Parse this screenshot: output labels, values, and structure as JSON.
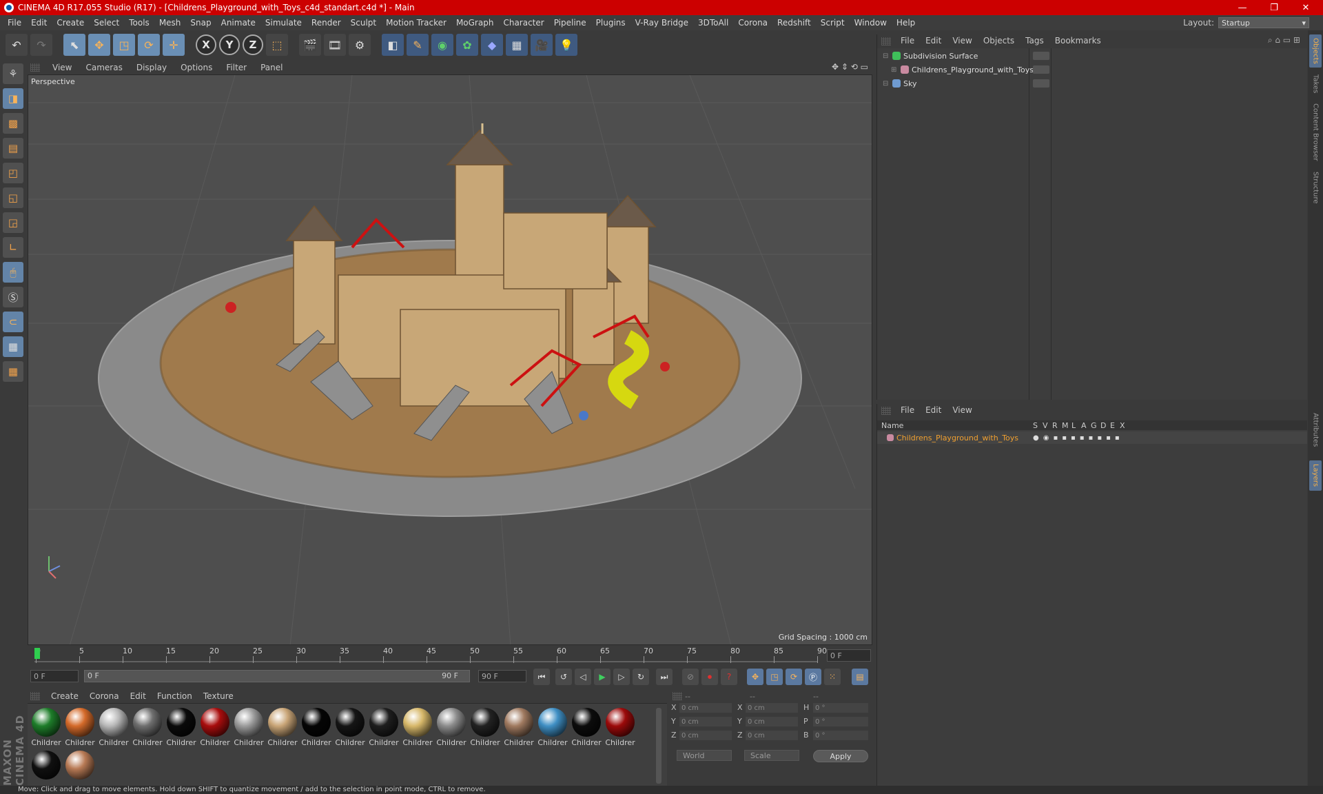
{
  "window": {
    "title": "CINEMA 4D R17.055 Studio (R17) - [Childrens_Playground_with_Toys_c4d_standart.c4d *] - Main",
    "minimize": "—",
    "restore": "❐",
    "close": "✕"
  },
  "menu": {
    "items": [
      "File",
      "Edit",
      "Create",
      "Select",
      "Tools",
      "Mesh",
      "Snap",
      "Animate",
      "Simulate",
      "Render",
      "Sculpt",
      "Motion Tracker",
      "MoGraph",
      "Character",
      "Pipeline",
      "Plugins",
      "V-Ray Bridge",
      "3DToAll",
      "Corona",
      "Redshift",
      "Script",
      "Window",
      "Help"
    ],
    "layout_label": "Layout:",
    "layout_value": "Startup"
  },
  "toolbar": {
    "axis_x": "X",
    "axis_y": "Y",
    "axis_z": "Z"
  },
  "viewport": {
    "menu": [
      "View",
      "Cameras",
      "Display",
      "Options",
      "Filter",
      "Panel"
    ],
    "camera_label": "Perspective",
    "grid_spacing": "Grid Spacing : 1000 cm"
  },
  "timeline": {
    "ticks": [
      "0",
      "5",
      "10",
      "15",
      "20",
      "25",
      "30",
      "35",
      "40",
      "45",
      "50",
      "55",
      "60",
      "65",
      "70",
      "75",
      "80",
      "85",
      "90"
    ],
    "current_frame": "0 F",
    "start_field": "0 F",
    "range_left": "0 F",
    "range_right": "90 F",
    "end_field": "90 F"
  },
  "materials": {
    "menu": [
      "Create",
      "Corona",
      "Edit",
      "Function",
      "Texture"
    ],
    "items": [
      {
        "label": "Childrer",
        "color": "#1e7d2a"
      },
      {
        "label": "Childrer",
        "color": "#d46a2a"
      },
      {
        "label": "Childrer",
        "color": "#b8b8b8"
      },
      {
        "label": "Childrer",
        "color": "#6f6f6f"
      },
      {
        "label": "Childrer",
        "color": "#0a0a0a"
      },
      {
        "label": "Childrer",
        "color": "#a80d0d"
      },
      {
        "label": "Childrer",
        "color": "#9b9b9b"
      },
      {
        "label": "Childrer",
        "color": "#c9a577"
      },
      {
        "label": "Childrer",
        "color": "#050505"
      },
      {
        "label": "Childrer",
        "color": "#151515"
      },
      {
        "label": "Childrer",
        "color": "#1e1e1e"
      },
      {
        "label": "Childrer",
        "color": "#d7b86a"
      },
      {
        "label": "Childrer",
        "color": "#8c8c8c"
      },
      {
        "label": "Childrer",
        "color": "#222222"
      },
      {
        "label": "Childrer",
        "color": "#a07a60"
      },
      {
        "label": "Childrer",
        "color": "#3f8fc4"
      },
      {
        "label": "Childrer",
        "color": "#0c0c0c"
      },
      {
        "label": "Childrer",
        "color": "#9c0a0a"
      },
      {
        "label": "",
        "color": "#101010"
      },
      {
        "label": "",
        "color": "#b87a55"
      }
    ]
  },
  "coords": {
    "header": [
      "--",
      "--",
      "--"
    ],
    "rows": [
      {
        "a": "X",
        "av": "0 cm",
        "b": "X",
        "bv": "0 cm",
        "c": "H",
        "cv": "0 °"
      },
      {
        "a": "Y",
        "av": "0 cm",
        "b": "Y",
        "bv": "0 cm",
        "c": "P",
        "cv": "0 °"
      },
      {
        "a": "Z",
        "av": "0 cm",
        "b": "Z",
        "bv": "0 cm",
        "c": "B",
        "cv": "0 °"
      }
    ],
    "mode": "World",
    "scale": "Scale",
    "apply": "Apply"
  },
  "object_manager": {
    "menu": [
      "File",
      "Edit",
      "View",
      "Objects",
      "Tags",
      "Bookmarks"
    ],
    "objects": [
      {
        "name": "Subdivision Surface",
        "color": "#3fbf5a",
        "level": 0
      },
      {
        "name": "Childrens_Playground_with_Toys",
        "color": "#c98aa0",
        "level": 1
      },
      {
        "name": "Sky",
        "color": "#6f9bd1",
        "level": 0
      }
    ]
  },
  "layer_manager": {
    "menu": [
      "File",
      "Edit",
      "View"
    ],
    "columns": [
      "Name",
      "S",
      "V",
      "R",
      "M",
      "L",
      "A",
      "G",
      "D",
      "E",
      "X"
    ],
    "layers": [
      {
        "name": "Childrens_Playground_with_Toys",
        "color": "#c98aa0"
      }
    ]
  },
  "side_tabs": [
    "Objects",
    "Takes",
    "Content Browser",
    "Structure",
    "Attributes",
    "Layers"
  ],
  "brand": "MAXON CINEMA 4D",
  "status": "Move: Click and drag to move elements. Hold down SHIFT to quantize movement / add to the selection in point mode, CTRL to remove."
}
